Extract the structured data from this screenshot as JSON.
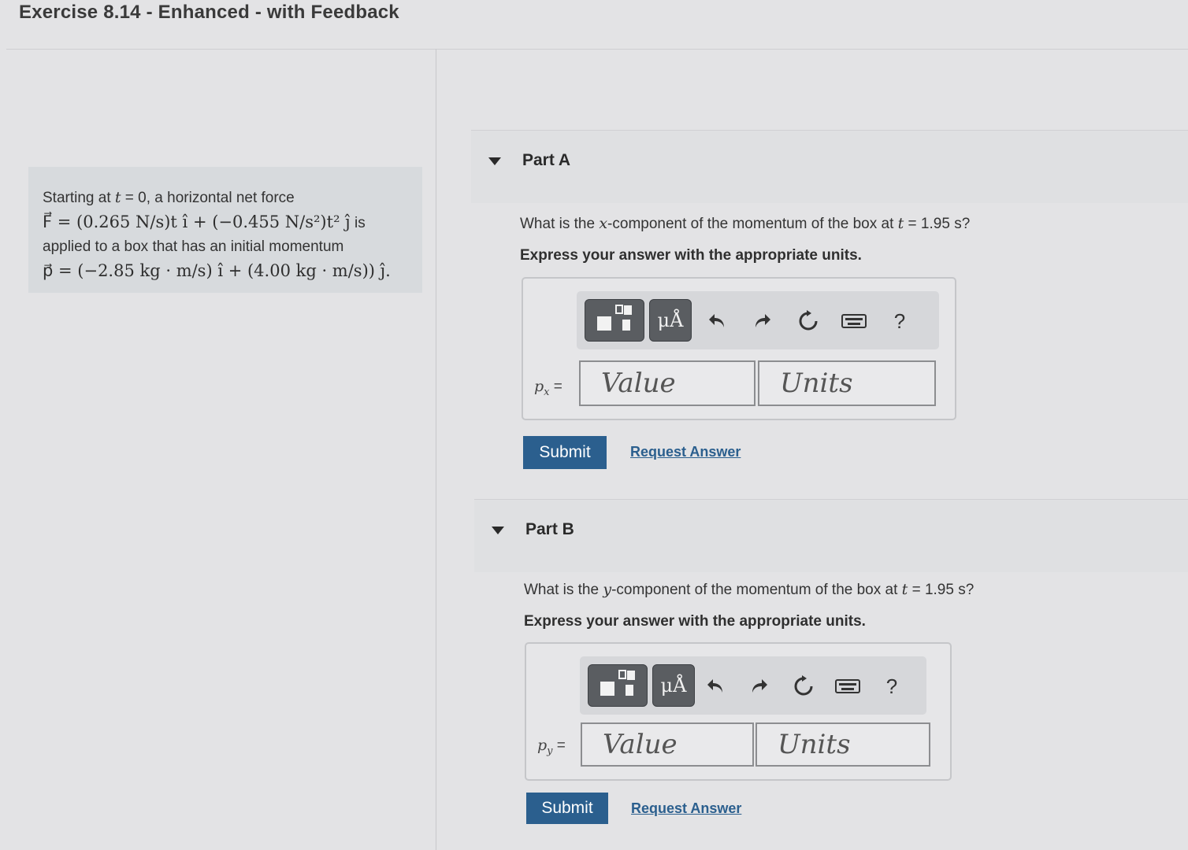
{
  "page": {
    "title": "Exercise 8.14 - Enhanced - with Feedback"
  },
  "problem": {
    "line1_a": "Starting at ",
    "line1_t": "t",
    "line1_b": " = 0, a horizontal net force",
    "line2_math": "F⃗ = (0.265 N/s)t î + (−0.455 N/s²)t² ĵ",
    "line2_suffix": " is",
    "line3": "applied to a box that has an initial momentum",
    "line4_math": "p⃗ = (−2.85 kg · m/s) î + (4.00 kg · m/s)) ĵ."
  },
  "toolbar": {
    "templates_icon": "templates-icon",
    "units_symbol": "μÅ",
    "undo_icon": "undo-icon",
    "redo_icon": "redo-icon",
    "reset_icon": "reset-icon",
    "keyboard_icon": "keyboard-icon",
    "help_symbol": "?"
  },
  "parts": [
    {
      "label": "Part A",
      "question_a": "What is the ",
      "question_var": "x",
      "question_b": "-component of the momentum of the box at ",
      "question_t": "t",
      "question_c": " = 1.95 s?",
      "instruction": "Express your answer with the appropriate units.",
      "var_label": "pₓ =",
      "value_placeholder": "Value",
      "units_placeholder": "Units",
      "submit": "Submit",
      "request": "Request Answer"
    },
    {
      "label": "Part B",
      "question_a": "What is the ",
      "question_var": "y",
      "question_b": "-component of the momentum of the box at ",
      "question_t": "t",
      "question_c": " = 1.95 s?",
      "instruction": "Express your answer with the appropriate units.",
      "var_label": "p_y =",
      "value_placeholder": "Value",
      "units_placeholder": "Units",
      "submit": "Submit",
      "request": "Request Answer"
    }
  ],
  "colors": {
    "accent": "#2b5f8e",
    "toolbar_button": "#5a5d61"
  }
}
